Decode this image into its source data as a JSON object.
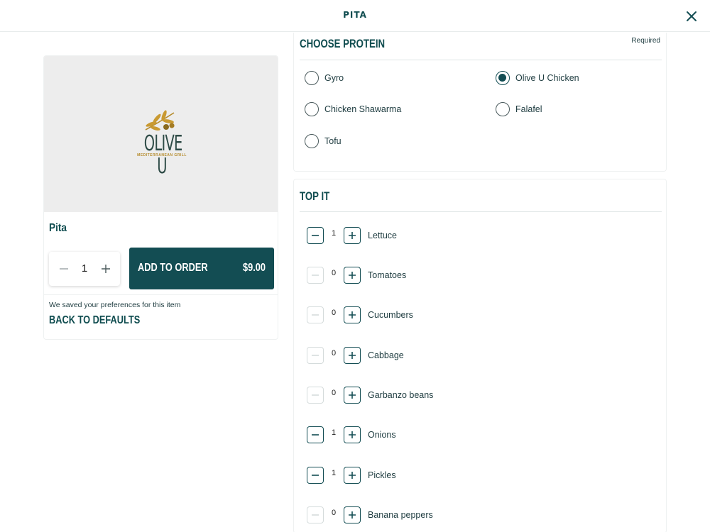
{
  "header": {
    "title": "PITA"
  },
  "item": {
    "name": "Pita",
    "logo_text": "OLIVE U",
    "logo_subtext": "MEDITERRANEAN GRILL",
    "quantity": "1",
    "add_label": "ADD TO ORDER",
    "price": "$9.00",
    "pref_note": "We saved your preferences for this item",
    "defaults_label": "BACK TO DEFAULTS"
  },
  "protein": {
    "title": "CHOOSE PROTEIN",
    "required": "Required",
    "options": [
      {
        "label": "Gyro",
        "selected": false
      },
      {
        "label": "Olive U Chicken",
        "selected": true
      },
      {
        "label": "Chicken Shawarma",
        "selected": false
      },
      {
        "label": "Falafel",
        "selected": false
      },
      {
        "label": "Tofu",
        "selected": false
      }
    ]
  },
  "toppings": {
    "title": "TOP IT",
    "items": [
      {
        "label": "Lettuce",
        "count": "1"
      },
      {
        "label": "Tomatoes",
        "count": "0"
      },
      {
        "label": "Cucumbers",
        "count": "0"
      },
      {
        "label": "Cabbage",
        "count": "0"
      },
      {
        "label": "Garbanzo beans",
        "count": "0"
      },
      {
        "label": "Onions",
        "count": "1"
      },
      {
        "label": "Pickles",
        "count": "1"
      },
      {
        "label": "Banana peppers",
        "count": "0"
      }
    ]
  },
  "colors": {
    "brand": "#134d53",
    "gold": "#b48a2a"
  },
  "icons": {
    "close": "close-icon",
    "minus": "minus-icon",
    "plus": "plus-icon",
    "logo": "olive-branch-icon"
  }
}
